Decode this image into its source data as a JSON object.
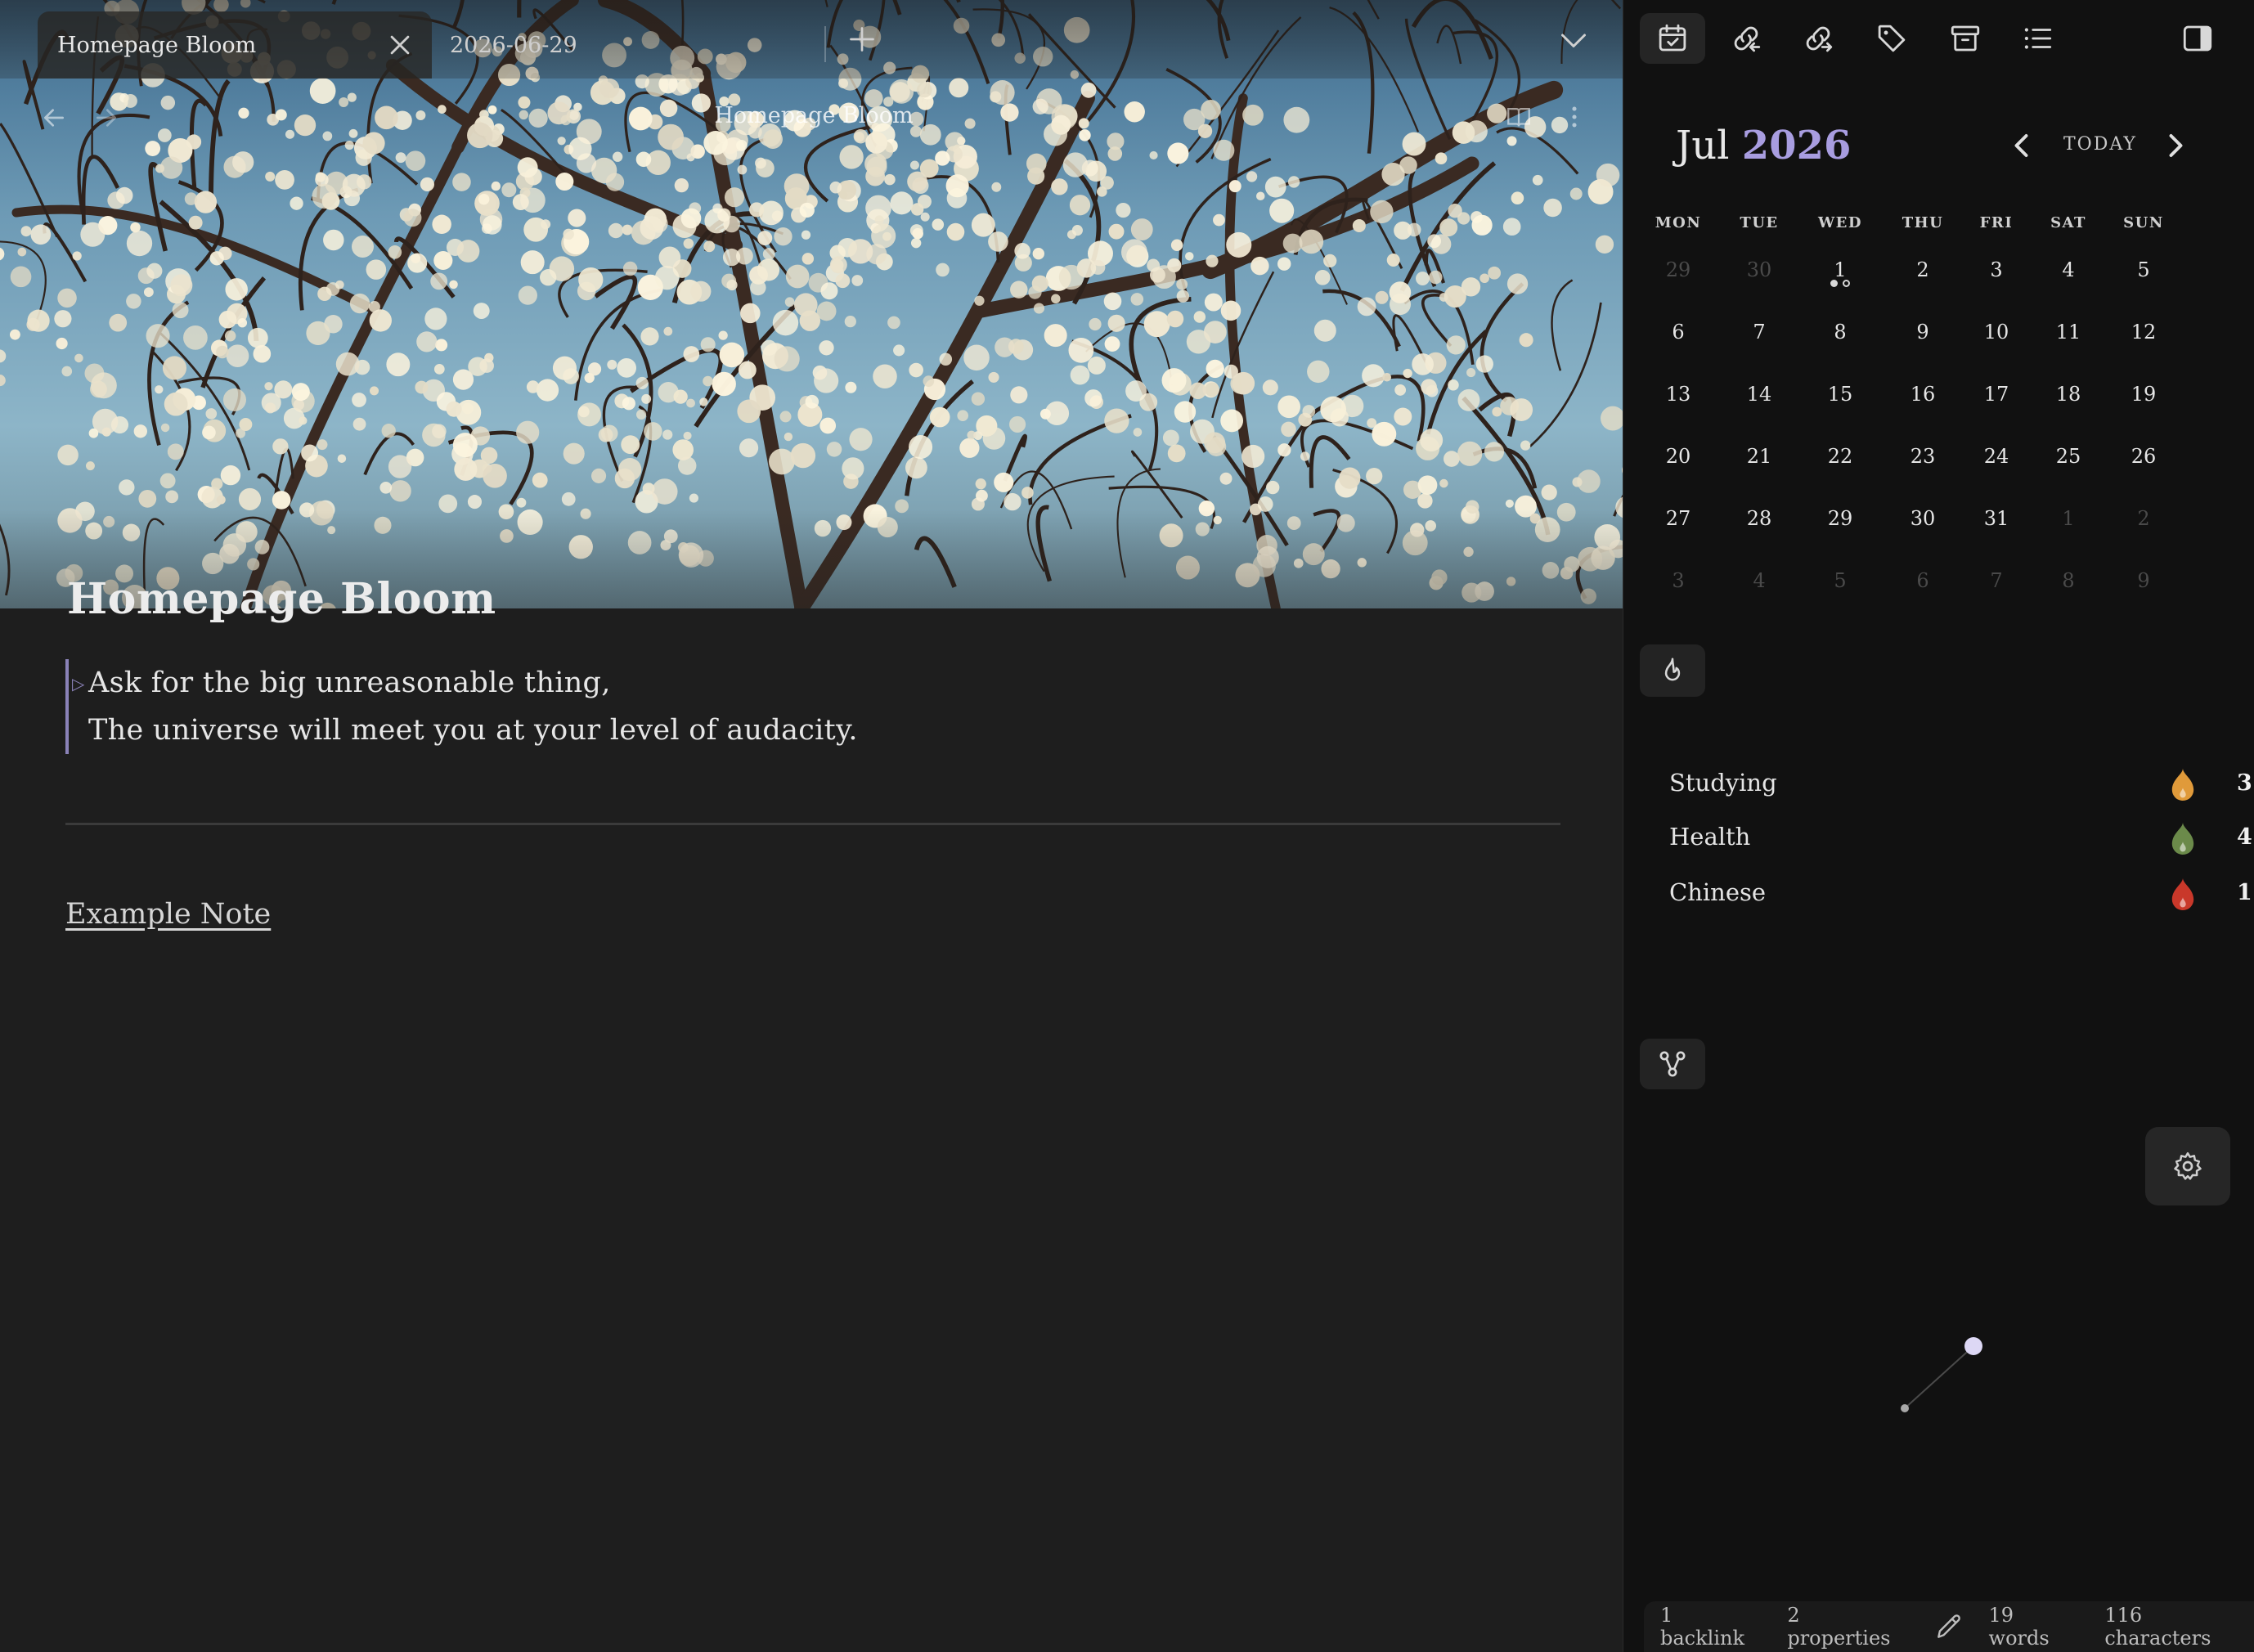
{
  "tabs": [
    {
      "label": "Homepage Bloom",
      "active": true
    },
    {
      "label": "2026-06-29",
      "active": false
    }
  ],
  "view_header": {
    "title": "Homepage Bloom"
  },
  "note": {
    "title": "Homepage Bloom",
    "callout_lines": [
      "Ask for the big unreasonable thing,",
      "The universe will meet you at your level of audacity."
    ],
    "link_label": "Example Note"
  },
  "right_toolbar": {
    "icons": [
      "calendar-check-icon",
      "backlinks-icon",
      "outgoing-links-icon",
      "tag-icon",
      "archive-icon",
      "outline-list-icon",
      "sidebar-toggle-icon"
    ]
  },
  "calendar": {
    "month": "Jul",
    "year": "2026",
    "today_label": "TODAY",
    "weekdays": [
      "MON",
      "TUE",
      "WED",
      "THU",
      "FRI",
      "SAT",
      "SUN"
    ],
    "weeks": [
      [
        {
          "d": "29",
          "dim": true
        },
        {
          "d": "30",
          "dim": true
        },
        {
          "d": "1",
          "dots": [
            "filled",
            "hollow"
          ]
        },
        {
          "d": "2"
        },
        {
          "d": "3"
        },
        {
          "d": "4"
        },
        {
          "d": "5"
        }
      ],
      [
        {
          "d": "6"
        },
        {
          "d": "7"
        },
        {
          "d": "8"
        },
        {
          "d": "9"
        },
        {
          "d": "10"
        },
        {
          "d": "11"
        },
        {
          "d": "12"
        }
      ],
      [
        {
          "d": "13"
        },
        {
          "d": "14"
        },
        {
          "d": "15"
        },
        {
          "d": "16"
        },
        {
          "d": "17"
        },
        {
          "d": "18"
        },
        {
          "d": "19"
        }
      ],
      [
        {
          "d": "20"
        },
        {
          "d": "21"
        },
        {
          "d": "22"
        },
        {
          "d": "23"
        },
        {
          "d": "24"
        },
        {
          "d": "25"
        },
        {
          "d": "26"
        }
      ],
      [
        {
          "d": "27"
        },
        {
          "d": "28"
        },
        {
          "d": "29"
        },
        {
          "d": "30"
        },
        {
          "d": "31"
        },
        {
          "d": "1",
          "dim": true
        },
        {
          "d": "2",
          "dim": true
        }
      ],
      [
        {
          "d": "3",
          "dim": true
        },
        {
          "d": "4",
          "dim": true
        },
        {
          "d": "5",
          "dim": true
        },
        {
          "d": "6",
          "dim": true
        },
        {
          "d": "7",
          "dim": true
        },
        {
          "d": "8",
          "dim": true
        },
        {
          "d": "9",
          "dim": true
        }
      ]
    ]
  },
  "habits": [
    {
      "label": "Studying",
      "count": "3",
      "color": "#e09a3a"
    },
    {
      "label": "Health",
      "count": "4",
      "color": "#6b8a4a"
    },
    {
      "label": "Chinese",
      "count": "1",
      "color": "#c9382a"
    }
  ],
  "status_bar": {
    "backlinks": "1 backlink",
    "properties": "2 properties",
    "words": "19 words",
    "characters": "116 characters"
  },
  "colors": {
    "accent": "#a89de0",
    "callout_border": "#8a82b8",
    "background": "#1e1e1e",
    "sidebar_background": "#111111"
  }
}
